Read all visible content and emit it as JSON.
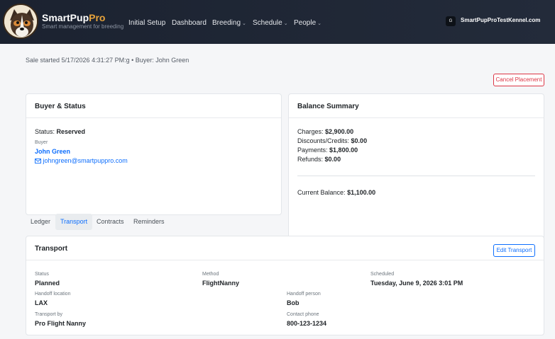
{
  "brand": {
    "name_a": "SmartPup",
    "name_b": "Pro",
    "tagline": "Smart management for breeding"
  },
  "nav": {
    "items": [
      {
        "label": "Initial Setup",
        "caret": ""
      },
      {
        "label": "Dashboard",
        "caret": ""
      },
      {
        "label": "Breeding",
        "caret": "⌄"
      },
      {
        "label": "Schedule",
        "caret": "⌄"
      },
      {
        "label": "People",
        "caret": "⌄"
      }
    ],
    "user_initial": "G",
    "user_name": "SmartPupProTestKennel.com",
    "user_caret": "⌄"
  },
  "sale": {
    "started_text": "Sale started 5/17/2026 4:31:27 PM:g • Buyer: John Green"
  },
  "actions": {
    "cancel_placement": "Cancel Placement",
    "edit_transport": "Edit Transport"
  },
  "buyer_card": {
    "title": "Buyer & Status",
    "status_label": "Status:",
    "status_value": "Reserved",
    "buyer_label": "Buyer",
    "buyer_name": "John Green",
    "buyer_email": "johngreen@smartpuppro.com"
  },
  "balance_card": {
    "title": "Balance Summary",
    "charges_label": "Charges:",
    "charges_value": "$2,900.00",
    "discounts_label": "Discounts/Credits:",
    "discounts_value": "$0.00",
    "payments_label": "Payments:",
    "payments_value": "$1,800.00",
    "refunds_label": "Refunds:",
    "refunds_value": "$0.00",
    "current_label": "Current Balance:",
    "current_value": "$1,100.00"
  },
  "tabs": [
    {
      "label": "Ledger"
    },
    {
      "label": "Transport"
    },
    {
      "label": "Contracts"
    },
    {
      "label": "Reminders"
    }
  ],
  "active_tab": "Transport",
  "transport": {
    "title": "Transport",
    "status_label": "Status",
    "status_value": "Planned",
    "method_label": "Method",
    "method_value": "FlightNanny",
    "scheduled_label": "Scheduled",
    "scheduled_value": "Tuesday, June 9, 2026 3:01 PM",
    "handoff_location_label": "Handoff location",
    "handoff_location_value": "LAX",
    "handoff_person_label": "Handoff person",
    "handoff_person_value": "Bob",
    "transport_by_label": "Transport by",
    "transport_by_value": "Pro Flight Nanny",
    "contact_phone_label": "Contact phone",
    "contact_phone_value": "800-123-1234"
  },
  "colors": {
    "navbar": "#1b2230",
    "primary": "#0d6efd",
    "danger": "#dc3545",
    "brand_accent": "#e7a33b"
  },
  "icons": {
    "email": "envelope-icon",
    "logo": "dog-logo-icon"
  }
}
